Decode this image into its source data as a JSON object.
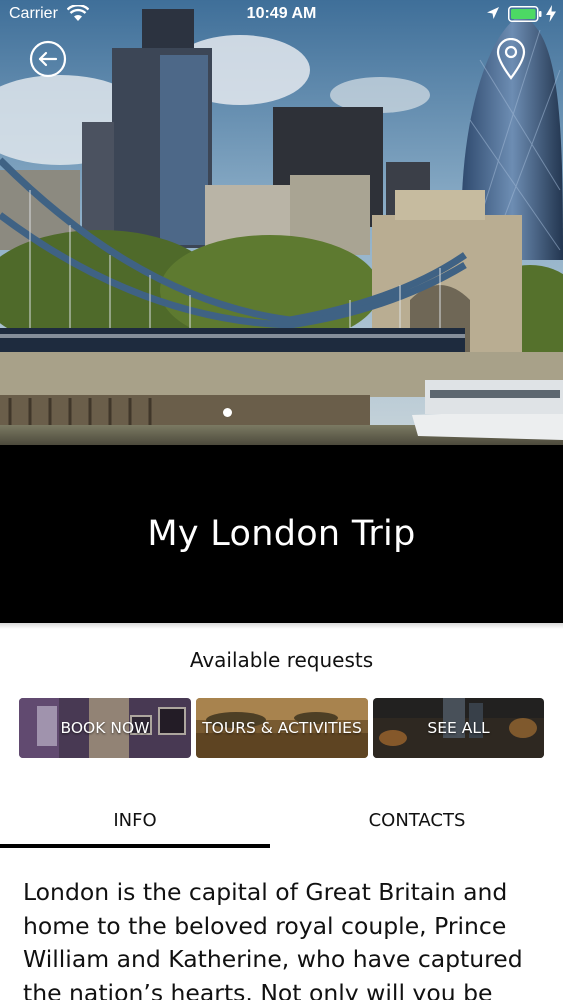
{
  "status_bar": {
    "carrier": "Carrier",
    "time": "10:49 AM",
    "battery_color": "#4cd964"
  },
  "header": {
    "back_icon": "back-arrow-icon",
    "location_icon": "map-pin-icon",
    "gallery_page_count": 1,
    "gallery_current_page": 1
  },
  "trip": {
    "title": "My London Trip"
  },
  "requests": {
    "heading": "Available requests",
    "cards": [
      {
        "label": "BOOK NOW"
      },
      {
        "label": "TOURS & ACTIVITIES"
      },
      {
        "label": "SEE ALL"
      }
    ]
  },
  "tabs": [
    {
      "label": "INFO",
      "selected": true
    },
    {
      "label": "CONTACTS",
      "selected": false
    }
  ],
  "info": {
    "text": "London is the capital of Great Britain and home to the beloved royal couple, Prince William and Katherine, who have captured the nation’s hearts. Not only will you be"
  }
}
